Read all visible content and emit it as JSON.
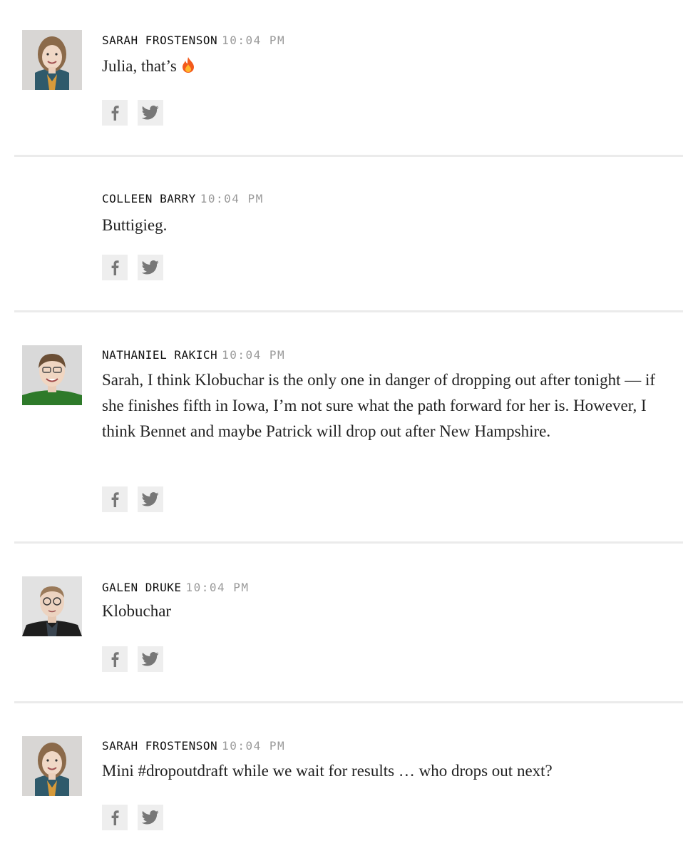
{
  "feed": {
    "entries": [
      {
        "author": "SARAH FROSTENSON",
        "time": "10:04 PM",
        "text": "Julia, that’s",
        "emoji": "🔥",
        "has_avatar": true,
        "avatar": "sarah-frostenson"
      },
      {
        "author": "COLLEEN BARRY",
        "time": "10:04 PM",
        "text": "Buttigieg.",
        "has_avatar": false
      },
      {
        "author": "NATHANIEL RAKICH",
        "time": "10:04 PM",
        "text": "Sarah, I think Klobuchar is the only one in danger of dropping out after tonight — if she finishes fifth in Iowa, I’m not sure what the path forward for her is. However, I think Bennet and maybe Patrick will drop out after New Hampshire.",
        "has_avatar": true,
        "avatar": "nathaniel-rakich"
      },
      {
        "author": "GALEN DRUKE",
        "time": "10:04 PM",
        "text": "Klobuchar",
        "has_avatar": true,
        "avatar": "galen-druke"
      },
      {
        "author": "SARAH FROSTENSON",
        "time": "10:04 PM",
        "text": "Mini #dropoutdraft while we wait for results … who drops out next?",
        "has_avatar": true,
        "avatar": "sarah-frostenson"
      }
    ]
  },
  "icons": {
    "facebook": "facebook-icon",
    "twitter": "twitter-icon"
  },
  "colors": {
    "share_bg": "#eeeeee",
    "share_icon": "#777777",
    "divider": "#ebebeb",
    "time": "#9a9a9a",
    "author": "#111111"
  }
}
